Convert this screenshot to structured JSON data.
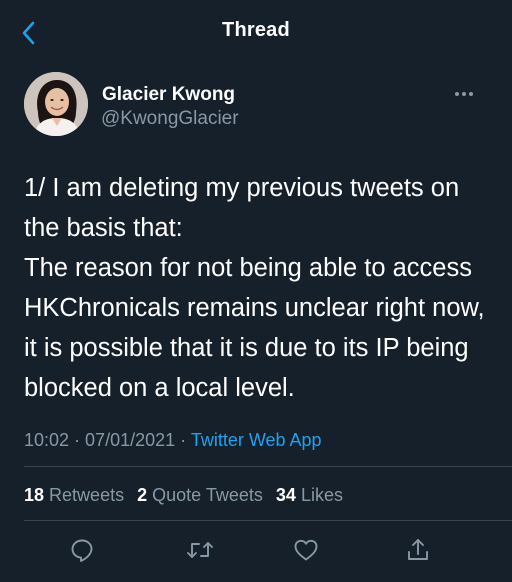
{
  "header": {
    "title": "Thread",
    "back_icon": "chevron-left-icon"
  },
  "colors": {
    "background": "#15202b",
    "accent": "#1da1f2",
    "secondary_text": "#8899a6",
    "divider": "#38444d"
  },
  "author": {
    "name": "Glacier Kwong",
    "handle": "@KwongGlacier",
    "more_icon": "more-horizontal-icon"
  },
  "tweet": {
    "text": "1/ I am deleting my previous tweets on the basis that:\nThe reason for not being able to access  HKChronicals remains unclear right now, it is possible that it is due to its IP being blocked on a local level.",
    "time": "10:02",
    "separator1": " · ",
    "date": "07/01/2021",
    "separator2": " · ",
    "source": "Twitter Web App"
  },
  "stats": {
    "retweets_count": "18",
    "retweets_label": "Retweets",
    "quotes_count": "2",
    "quotes_label": "Quote Tweets",
    "likes_count": "34",
    "likes_label": "Likes"
  },
  "actions": {
    "reply_icon": "reply-icon",
    "retweet_icon": "retweet-icon",
    "like_icon": "heart-icon",
    "share_icon": "share-icon"
  }
}
